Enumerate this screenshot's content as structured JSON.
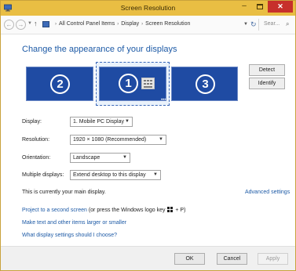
{
  "window": {
    "title": "Screen Resolution",
    "controls": {
      "minimize": "–",
      "close": "✕"
    }
  },
  "address": {
    "back": "←",
    "forward": "→",
    "up": "↑",
    "breadcrumbs": [
      "All Control Panel Items",
      "Display",
      "Screen Resolution"
    ],
    "separator": "›",
    "refresh": "↻",
    "search_placeholder": "Sear..."
  },
  "heading": "Change the appearance of your displays",
  "monitors": [
    {
      "number": "2",
      "selected": false
    },
    {
      "number": "1",
      "selected": true
    },
    {
      "number": "3",
      "selected": false
    }
  ],
  "buttons": {
    "detect": "Detect",
    "identify": "Identify"
  },
  "form": {
    "display": {
      "label": "Display:",
      "value": "1. Mobile PC Display"
    },
    "resolution": {
      "label": "Resolution:",
      "value": "1920 × 1080 (Recommended)"
    },
    "orientation": {
      "label": "Orientation:",
      "value": "Landscape"
    },
    "multiple": {
      "label": "Multiple displays:",
      "value": "Extend desktop to this display"
    }
  },
  "main_display_text": "This is currently your main display.",
  "links": {
    "advanced": "Advanced settings",
    "project": "Project to a second screen",
    "project_hint_before": " (or press the Windows logo key ",
    "project_hint_after": " + P)",
    "text_size": "Make text and other items larger or smaller",
    "which_settings": "What display settings should I choose?"
  },
  "footer": {
    "ok": "OK",
    "cancel": "Cancel",
    "apply": "Apply"
  },
  "colors": {
    "titlebar": "#e9be43",
    "close": "#c7302b",
    "monitor": "#1f4ba3",
    "link": "#1d5aa6"
  }
}
